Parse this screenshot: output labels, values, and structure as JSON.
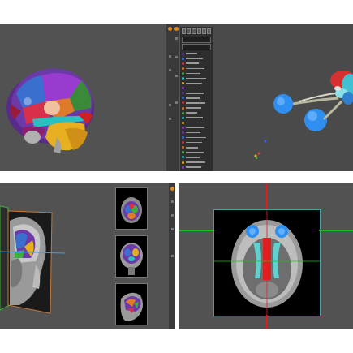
{
  "colors": {
    "viewport_bg": "#525252",
    "viewport_bg_dark": "#4a4a4a",
    "toolbar_bg": "#3a3a3a",
    "list_bg": "#2e2e2e",
    "accent_orange": "#e08a1e",
    "frame_orange": "#c07a3a",
    "frame_green": "#3fae3f",
    "crosshair_red": "#e02020",
    "crosshair_green": "#20c020"
  },
  "right_panel": {
    "toolbar_icons": [
      "select-tool-icon",
      "pan-tool-icon",
      "zoom-tool-icon",
      "rotate-tool-icon",
      "measure-tool-icon",
      "settings-icon"
    ],
    "field_1": "",
    "field_2": "",
    "structure_count": 25
  },
  "bottom_left": {
    "thumbnails": [
      "axial",
      "coronal",
      "sagittal"
    ]
  },
  "bottom_right": {
    "status": ""
  }
}
